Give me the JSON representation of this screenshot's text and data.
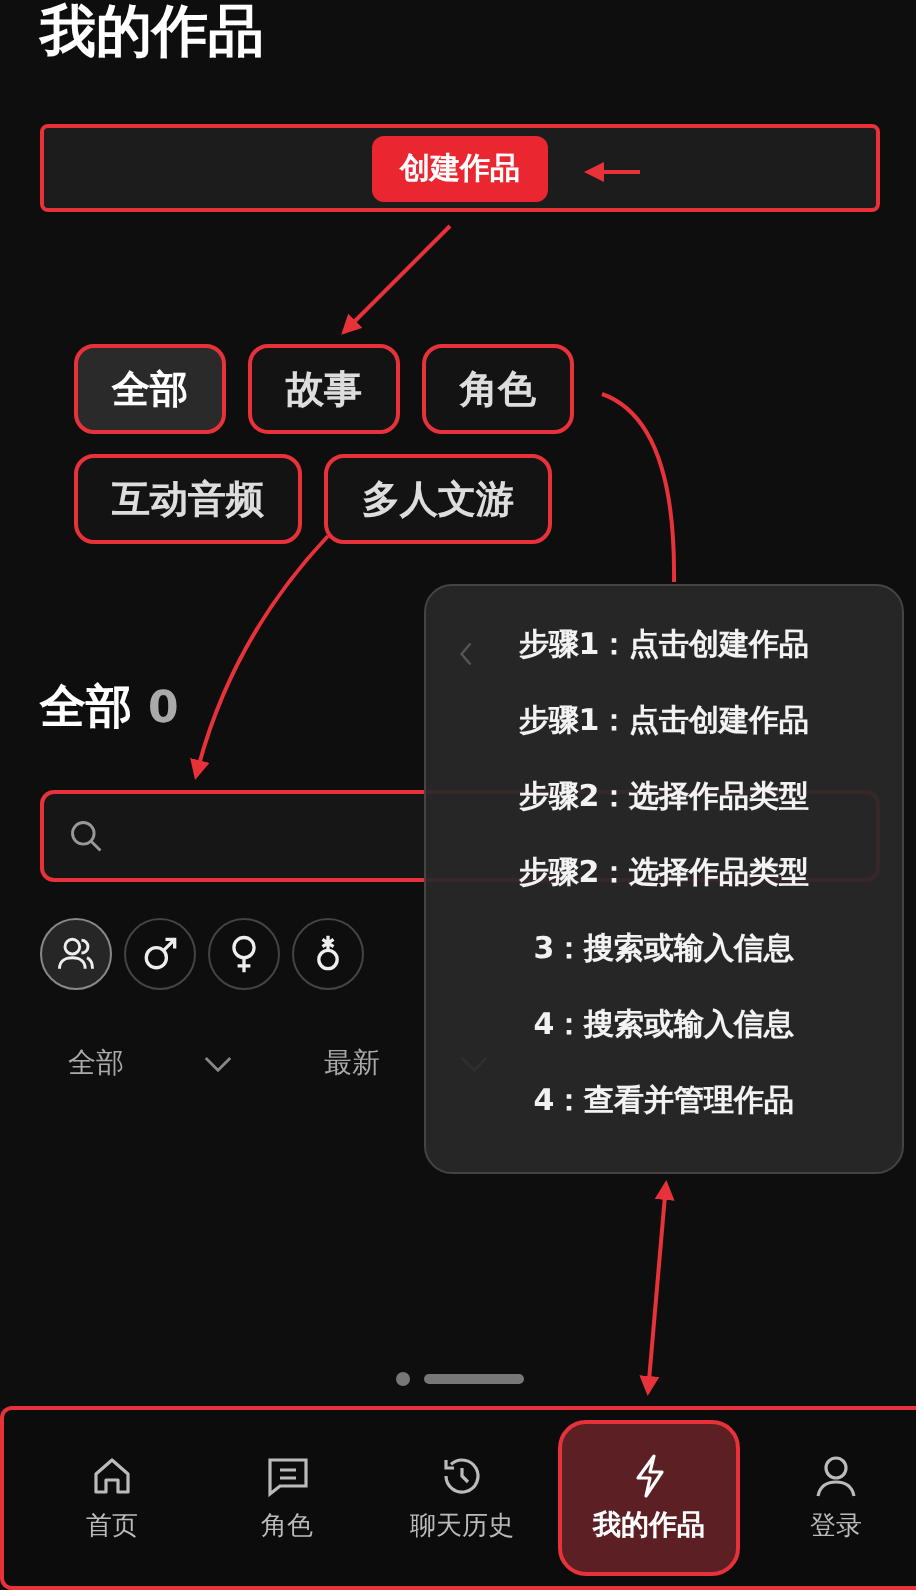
{
  "title": "我的作品",
  "create_button": "创建作品",
  "filters": [
    {
      "label": "全部",
      "selected": true
    },
    {
      "label": "故事",
      "selected": false
    },
    {
      "label": "角色",
      "selected": false
    },
    {
      "label": "互动音频",
      "selected": false
    },
    {
      "label": "多人文游",
      "selected": false
    }
  ],
  "section": {
    "title": "全部",
    "count": "0"
  },
  "gender_filters": [
    {
      "kind": "all",
      "selected": true
    },
    {
      "kind": "male",
      "selected": false
    },
    {
      "kind": "female",
      "selected": false
    },
    {
      "kind": "other",
      "selected": false
    }
  ],
  "sorts": [
    {
      "label": "全部"
    },
    {
      "label": "最新"
    }
  ],
  "steps": [
    "步骤1：点击创建作品",
    "步骤1：点击创建作品",
    "步骤2：选择作品类型",
    "步骤2：选择作品类型",
    "3：搜索或输入信息",
    "4：搜索或输入信息",
    "4：查看并管理作品"
  ],
  "nav": [
    {
      "label": "首页",
      "kind": "home",
      "selected": false
    },
    {
      "label": "角色",
      "kind": "chat",
      "selected": false
    },
    {
      "label": "聊天历史",
      "kind": "history",
      "selected": false
    },
    {
      "label": "我的作品",
      "kind": "bolt",
      "selected": true
    },
    {
      "label": "登录",
      "kind": "user",
      "selected": false
    }
  ]
}
